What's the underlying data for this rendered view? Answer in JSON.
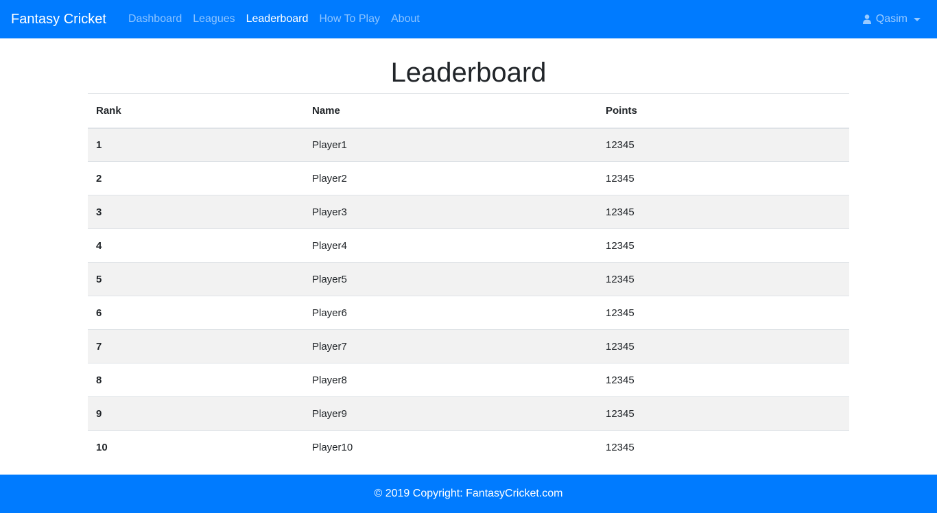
{
  "navbar": {
    "brand": "Fantasy Cricket",
    "links": [
      {
        "label": "Dashboard",
        "active": false
      },
      {
        "label": "Leagues",
        "active": false
      },
      {
        "label": "Leaderboard",
        "active": true
      },
      {
        "label": "How To Play",
        "active": false
      },
      {
        "label": "About",
        "active": false
      }
    ],
    "user": {
      "name": "Qasim",
      "icon": "user-icon"
    }
  },
  "main": {
    "title": "Leaderboard",
    "table": {
      "headers": [
        "Rank",
        "Name",
        "Points"
      ],
      "rows": [
        [
          "1",
          "Player1",
          "12345"
        ],
        [
          "2",
          "Player2",
          "12345"
        ],
        [
          "3",
          "Player3",
          "12345"
        ],
        [
          "4",
          "Player4",
          "12345"
        ],
        [
          "5",
          "Player5",
          "12345"
        ],
        [
          "6",
          "Player6",
          "12345"
        ],
        [
          "7",
          "Player7",
          "12345"
        ],
        [
          "8",
          "Player8",
          "12345"
        ],
        [
          "9",
          "Player9",
          "12345"
        ],
        [
          "10",
          "Player10",
          "12345"
        ]
      ]
    }
  },
  "footer": {
    "text": "© 2019 Copyright: FantasyCricket.com"
  },
  "colors": {
    "primary": "#007bff",
    "stripe": "#f2f2f2",
    "border": "#dee2e6"
  }
}
